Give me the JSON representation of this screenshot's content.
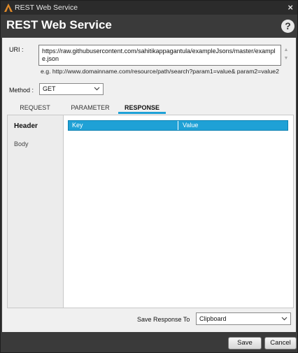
{
  "window": {
    "title": "REST Web Service",
    "close_glyph": "×"
  },
  "header": {
    "heading": "REST Web Service",
    "help_glyph": "?"
  },
  "uri": {
    "label": "URI :",
    "value": "https://raw.githubusercontent.com/sahitikappagantula/exampleJsons/master/example.json",
    "example": "e.g. http://www.domainname.com/resource/path/search?param1=value& param2=value2"
  },
  "method": {
    "label": "Method :",
    "selected": "GET"
  },
  "tabs": [
    {
      "label": "REQUEST",
      "active": false
    },
    {
      "label": "PARAMETER",
      "active": false
    },
    {
      "label": "RESPONSE",
      "active": true
    }
  ],
  "response": {
    "side_items": [
      "Header",
      "Body"
    ],
    "columns": [
      "Key",
      "Value"
    ]
  },
  "save_response": {
    "label": "Save Response To",
    "selected": "Clipboard"
  },
  "buttons": {
    "save": "Save",
    "cancel": "Cancel"
  },
  "colors": {
    "accent": "#1fa1d6",
    "titlebar": "#2b2b2b",
    "frame": "#3a3a3a",
    "content": "#f0f0f0"
  },
  "icons": {
    "app": "app-logo-icon",
    "close": "close-icon",
    "help": "help-icon",
    "dropdown": "chevron-down-icon"
  }
}
